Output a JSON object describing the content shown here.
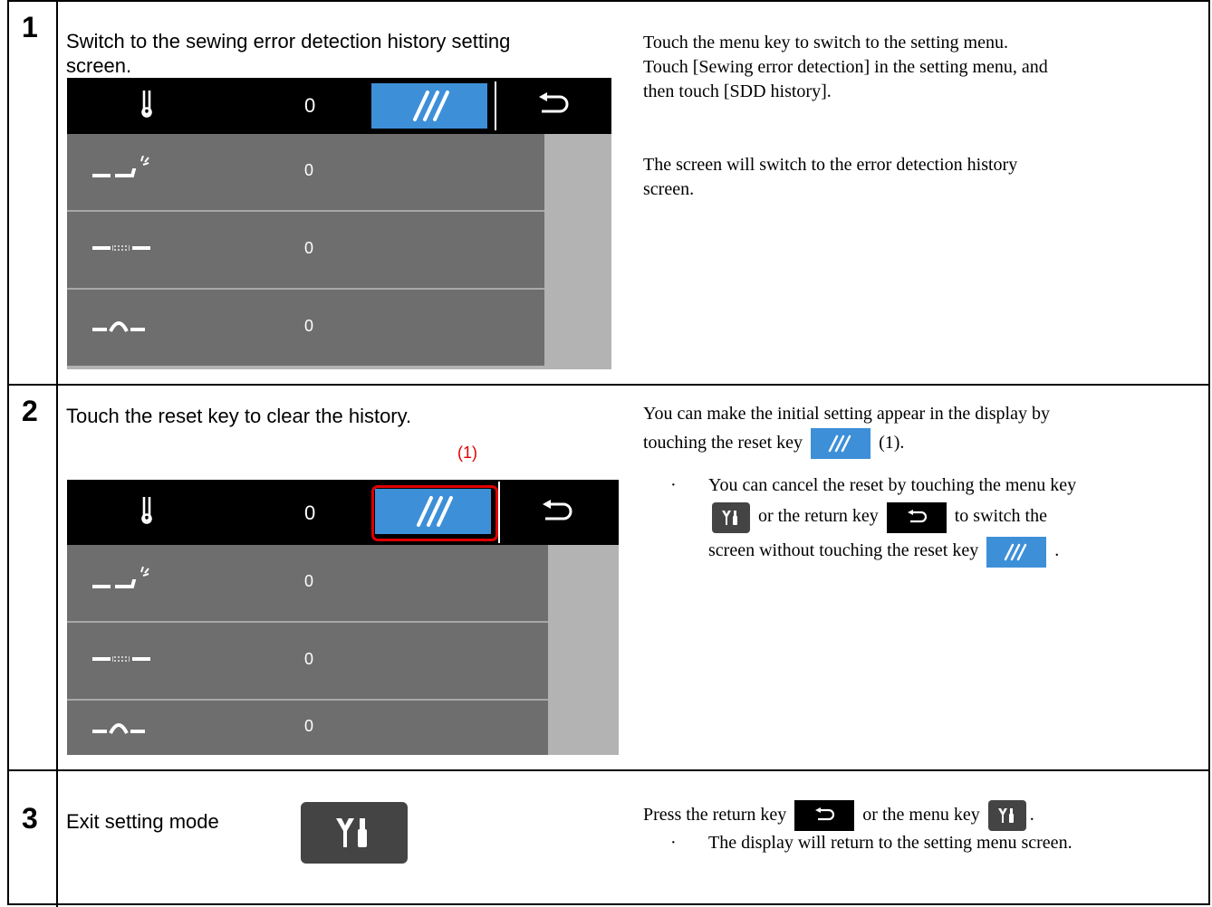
{
  "steps": [
    {
      "number": "1",
      "instruction_line1": "Switch to the sewing error detection history setting",
      "instruction_line2": "screen.",
      "screen": {
        "count": "0",
        "rows": [
          {
            "icon": "skip-stitch-icon",
            "value": "0"
          },
          {
            "icon": "thread-break-icon",
            "value": "0"
          },
          {
            "icon": "loop-stitch-icon",
            "value": "0"
          }
        ]
      },
      "description_line1": "Touch the menu key to switch to the setting menu.",
      "description_line2": "Touch [Sewing error detection] in the setting menu, and",
      "description_line3": "then touch [SDD history].",
      "description_line4": "The screen will switch to the error detection history",
      "description_line5": "screen."
    },
    {
      "number": "2",
      "instruction": "Touch the reset key to clear the history.",
      "callout_label": "(1)",
      "screen": {
        "count": "0",
        "rows": [
          {
            "icon": "skip-stitch-icon",
            "value": "0"
          },
          {
            "icon": "thread-break-icon",
            "value": "0"
          },
          {
            "icon": "loop-stitch-icon",
            "value": "0"
          }
        ]
      },
      "desc_a1": "You can make the initial setting appear in the display by",
      "desc_a2_before": "touching the reset key",
      "desc_a2_after": "(1).",
      "bullet": "·",
      "desc_b1": "You can cancel the reset by touching the menu key",
      "desc_b2_mid": "or the return key",
      "desc_b2_after": "to switch the",
      "desc_b3_before": "screen without touching the reset key",
      "desc_b3_after": "."
    },
    {
      "number": "3",
      "instruction": "Exit setting mode",
      "desc_before": "Press the return key",
      "desc_mid": "or the menu key",
      "desc_after": ".",
      "bullet": "·",
      "desc_note": "The display will return to the setting menu screen."
    }
  ],
  "colors": {
    "reset_key": "#3d8fd8",
    "menu_key": "#444444",
    "list_item": "#6e6e6e",
    "list_bg": "#b3b3b3",
    "highlight": "#e00000"
  }
}
